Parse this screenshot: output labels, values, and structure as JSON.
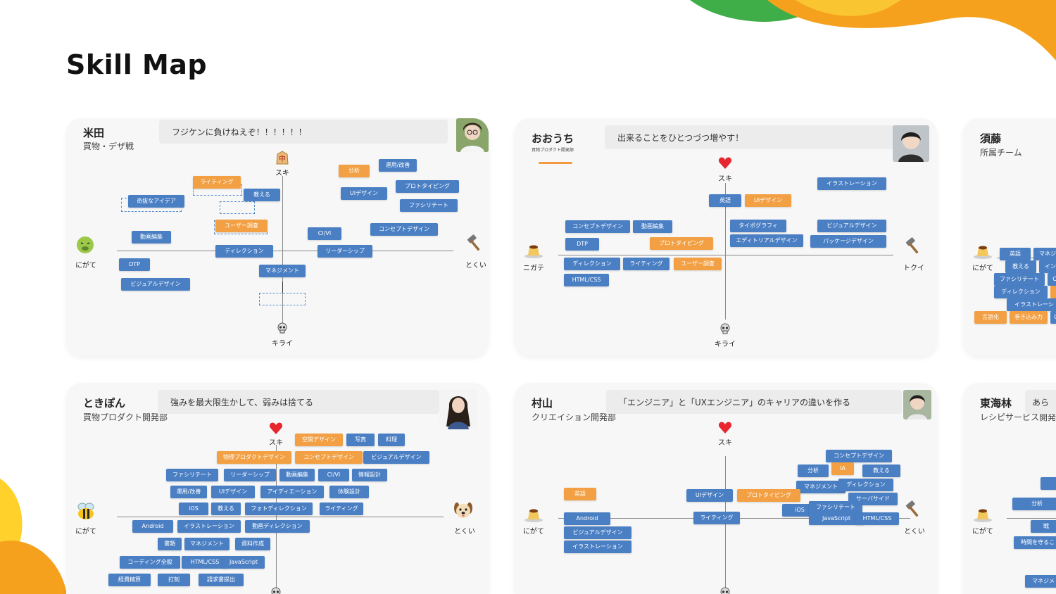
{
  "page": {
    "title": "Skill Map"
  },
  "colors": {
    "tag_blue": "#4a7fc4",
    "tag_orange": "#f2a043",
    "accent_green": "#3fae49",
    "accent_orange": "#f6a11d",
    "accent_yellow": "#ffd12a"
  },
  "cards": [
    {
      "name": "米田",
      "dept": "買物・デザ戦",
      "motto": "フジケンに負けねえぞ！！！！！！",
      "axis": {
        "top": "スキ",
        "bottom": "キライ",
        "left": "にがて",
        "right": "とくい"
      },
      "icons": {
        "top": "shogi-piece-icon",
        "bottom": "skull-icon",
        "left": "nauseated-face-icon",
        "right": "hammer-icon"
      },
      "tags": [
        {
          "label": "分析",
          "color": "orange"
        },
        {
          "label": "運用/改善",
          "color": "blue"
        },
        {
          "label": "ライティング",
          "color": "orange"
        },
        {
          "label": "プロトタイピング",
          "color": "blue"
        },
        {
          "label": "UIデザイン",
          "color": "blue"
        },
        {
          "label": "教える",
          "color": "blue"
        },
        {
          "label": "奇抜なアイデア",
          "color": "blue"
        },
        {
          "label": "ファシリテート",
          "color": "blue"
        },
        {
          "label": "ユーザー調査",
          "color": "orange"
        },
        {
          "label": "コンセプトデザイン",
          "color": "blue"
        },
        {
          "label": "CI/VI",
          "color": "blue"
        },
        {
          "label": "動画編集",
          "color": "blue"
        },
        {
          "label": "ディレクション",
          "color": "blue"
        },
        {
          "label": "リーダーシップ",
          "color": "blue"
        },
        {
          "label": "DTP",
          "color": "blue"
        },
        {
          "label": "マネジメント",
          "color": "blue"
        },
        {
          "label": "ビジュアルデザイン",
          "color": "blue"
        }
      ]
    },
    {
      "name": "おおうち",
      "dept": "買物プロダクト開発部",
      "motto": "出来ることをひとつづつ増やす！",
      "axis": {
        "top": "スキ",
        "bottom": "キライ",
        "left": "ニガテ",
        "right": "トクイ"
      },
      "icons": {
        "top": "heart-icon",
        "bottom": "skull-icon",
        "left": "pudding-icon",
        "right": "hammer-icon"
      },
      "tags": [
        {
          "label": "イラストレーション",
          "color": "blue"
        },
        {
          "label": "英語",
          "color": "blue"
        },
        {
          "label": "UIデザイン",
          "color": "orange"
        },
        {
          "label": "コンセプトデザイン",
          "color": "blue"
        },
        {
          "label": "動画編集",
          "color": "blue"
        },
        {
          "label": "タイポグラフィ",
          "color": "blue"
        },
        {
          "label": "ビジュアルデザイン",
          "color": "blue"
        },
        {
          "label": "DTP",
          "color": "blue"
        },
        {
          "label": "プロトタイピング",
          "color": "orange"
        },
        {
          "label": "エディトリアルデザイン",
          "color": "blue"
        },
        {
          "label": "パッケージデザイン",
          "color": "blue"
        },
        {
          "label": "ディレクション",
          "color": "blue"
        },
        {
          "label": "ライティング",
          "color": "blue"
        },
        {
          "label": "ユーザー調査",
          "color": "orange"
        },
        {
          "label": "HTML/CSS",
          "color": "blue"
        }
      ]
    },
    {
      "name": "須藤",
      "dept": "所属チーム",
      "axis": {
        "left": "にがて"
      },
      "icons": {
        "left": "pudding-icon"
      },
      "tags": [
        {
          "label": "英語",
          "color": "blue"
        },
        {
          "label": "マネジ",
          "color": "blue"
        },
        {
          "label": "教える",
          "color": "blue"
        },
        {
          "label": "イン",
          "color": "blue"
        },
        {
          "label": "ファシリテート",
          "color": "blue"
        },
        {
          "label": "C",
          "color": "blue"
        },
        {
          "label": "ディレクション",
          "color": "blue"
        },
        {
          "label": "",
          "color": "orange"
        },
        {
          "label": "イラストレーシ",
          "color": "blue"
        },
        {
          "label": "言語化",
          "color": "orange"
        },
        {
          "label": "巻き込み力",
          "color": "orange"
        },
        {
          "label": "C",
          "color": "blue"
        }
      ]
    },
    {
      "name": "ときぽん",
      "dept": "買物プロダクト開発部",
      "motto": "強みを最大限生かして、弱みは捨てる",
      "axis": {
        "top": "スキ",
        "left": "にがて",
        "right": "とくい"
      },
      "icons": {
        "top": "heart-icon",
        "bottom": "skull-icon",
        "left": "bee-icon",
        "right": "dog-face-icon"
      },
      "tags": [
        {
          "label": "空間デザイン",
          "color": "orange"
        },
        {
          "label": "写真",
          "color": "blue"
        },
        {
          "label": "料理",
          "color": "blue"
        },
        {
          "label": "物理プロダクトデザイン",
          "color": "orange"
        },
        {
          "label": "コンセプトデザイン",
          "color": "orange"
        },
        {
          "label": "ビジュアルデザイン",
          "color": "blue"
        },
        {
          "label": "ファシリテート",
          "color": "blue"
        },
        {
          "label": "リーダーシップ",
          "color": "blue"
        },
        {
          "label": "動画編集",
          "color": "blue"
        },
        {
          "label": "CI/VI",
          "color": "blue"
        },
        {
          "label": "情報設計",
          "color": "blue"
        },
        {
          "label": "運用/改善",
          "color": "blue"
        },
        {
          "label": "UIデザイン",
          "color": "blue"
        },
        {
          "label": "アイディエーション",
          "color": "blue"
        },
        {
          "label": "体験設計",
          "color": "blue"
        },
        {
          "label": "iOS",
          "color": "blue"
        },
        {
          "label": "教える",
          "color": "blue"
        },
        {
          "label": "フォトディレクション",
          "color": "blue"
        },
        {
          "label": "ライティング",
          "color": "blue"
        },
        {
          "label": "Android",
          "color": "blue"
        },
        {
          "label": "イラストレーション",
          "color": "blue"
        },
        {
          "label": "動画ディレクション",
          "color": "blue"
        },
        {
          "label": "書類",
          "color": "blue"
        },
        {
          "label": "マネジメント",
          "color": "blue"
        },
        {
          "label": "資料作成",
          "color": "blue"
        },
        {
          "label": "コーディング全般",
          "color": "blue"
        },
        {
          "label": "HTML/CSS",
          "color": "blue"
        },
        {
          "label": "JavaScript",
          "color": "blue"
        },
        {
          "label": "経費精算",
          "color": "blue"
        },
        {
          "label": "打刻",
          "color": "blue"
        },
        {
          "label": "請求書提出",
          "color": "blue"
        }
      ]
    },
    {
      "name": "村山",
      "dept": "クリエイション開発部",
      "motto": "「エンジニア」と「UXエンジニア」のキャリアの違いを作る",
      "axis": {
        "top": "スキ",
        "left": "にがて",
        "right": "とくい"
      },
      "icons": {
        "top": "heart-icon",
        "bottom": "skull-icon",
        "left": "pudding-icon",
        "right": "hammer-icon"
      },
      "tags": [
        {
          "label": "コンセプトデザイン",
          "color": "blue"
        },
        {
          "label": "分析",
          "color": "blue"
        },
        {
          "label": "IA",
          "color": "orange"
        },
        {
          "label": "教える",
          "color": "blue"
        },
        {
          "label": "マネジメント",
          "color": "blue"
        },
        {
          "label": "ディレクション",
          "color": "blue"
        },
        {
          "label": "英語",
          "color": "orange"
        },
        {
          "label": "UIデザイン",
          "color": "blue"
        },
        {
          "label": "プロトタイピング",
          "color": "orange"
        },
        {
          "label": "サーバサイド",
          "color": "blue"
        },
        {
          "label": "iOS",
          "color": "blue"
        },
        {
          "label": "ファシリテート",
          "color": "blue"
        },
        {
          "label": "JavaScript",
          "color": "blue"
        },
        {
          "label": "HTML/CSS",
          "color": "blue"
        },
        {
          "label": "Android",
          "color": "blue"
        },
        {
          "label": "ライティング",
          "color": "blue"
        },
        {
          "label": "ビジュアルデザイン",
          "color": "blue"
        },
        {
          "label": "イラストレーション",
          "color": "blue"
        }
      ]
    },
    {
      "name": "東海林",
      "dept": "レシピサービス開発",
      "motto": "あら",
      "axis": {
        "left": "にがて"
      },
      "icons": {
        "left": "pudding-icon"
      },
      "tags": [
        {
          "label": "",
          "color": "blue"
        },
        {
          "label": "分析",
          "color": "blue"
        },
        {
          "label": "戦",
          "color": "blue"
        },
        {
          "label": "時間を守るこ",
          "color": "blue"
        },
        {
          "label": "マネジメ",
          "color": "blue"
        }
      ]
    }
  ]
}
